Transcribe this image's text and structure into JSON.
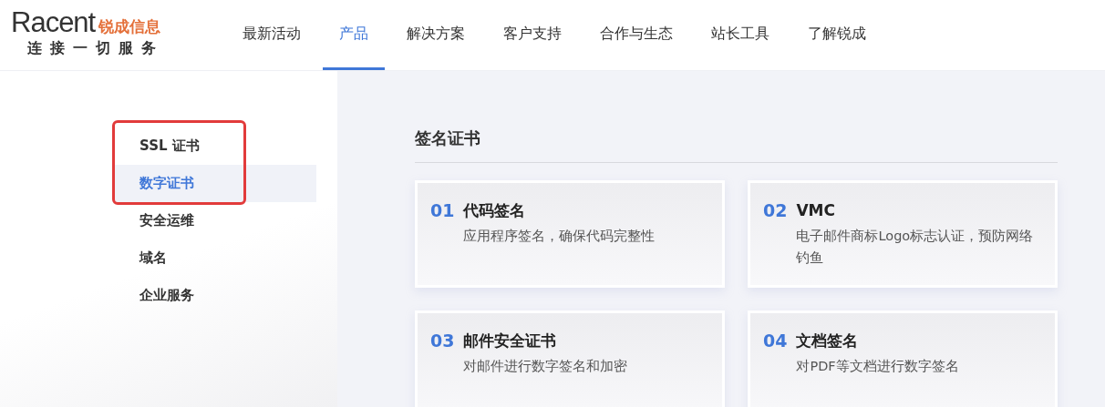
{
  "logo": {
    "wordmark": "Racent",
    "name": "锐成信息",
    "slogan": "连接一切服务"
  },
  "nav": [
    {
      "label": "最新活动",
      "selected": false
    },
    {
      "label": "产品",
      "selected": true
    },
    {
      "label": "解决方案",
      "selected": false
    },
    {
      "label": "客户支持",
      "selected": false
    },
    {
      "label": "合作与生态",
      "selected": false
    },
    {
      "label": "站长工具",
      "selected": false
    },
    {
      "label": "了解锐成",
      "selected": false
    }
  ],
  "sidebar": {
    "items": [
      {
        "label": "SSL 证书",
        "selected": false
      },
      {
        "label": "数字证书",
        "selected": true
      },
      {
        "label": "安全运维",
        "selected": false
      },
      {
        "label": "域名",
        "selected": false
      },
      {
        "label": "企业服务",
        "selected": false
      }
    ],
    "annotation_frame": true
  },
  "section": {
    "title": "签名证书",
    "cards": [
      {
        "number": "01",
        "title": "代码签名",
        "description": "应用程序签名，确保代码完整性"
      },
      {
        "number": "02",
        "title": "VMC",
        "description": "电子邮件商标Logo标志认证，预防网络钓鱼"
      },
      {
        "number": "03",
        "title": "邮件安全证书",
        "description": "对邮件进行数字签名和加密"
      },
      {
        "number": "04",
        "title": "文档签名",
        "description": "对PDF等文档进行数字签名"
      }
    ]
  }
}
